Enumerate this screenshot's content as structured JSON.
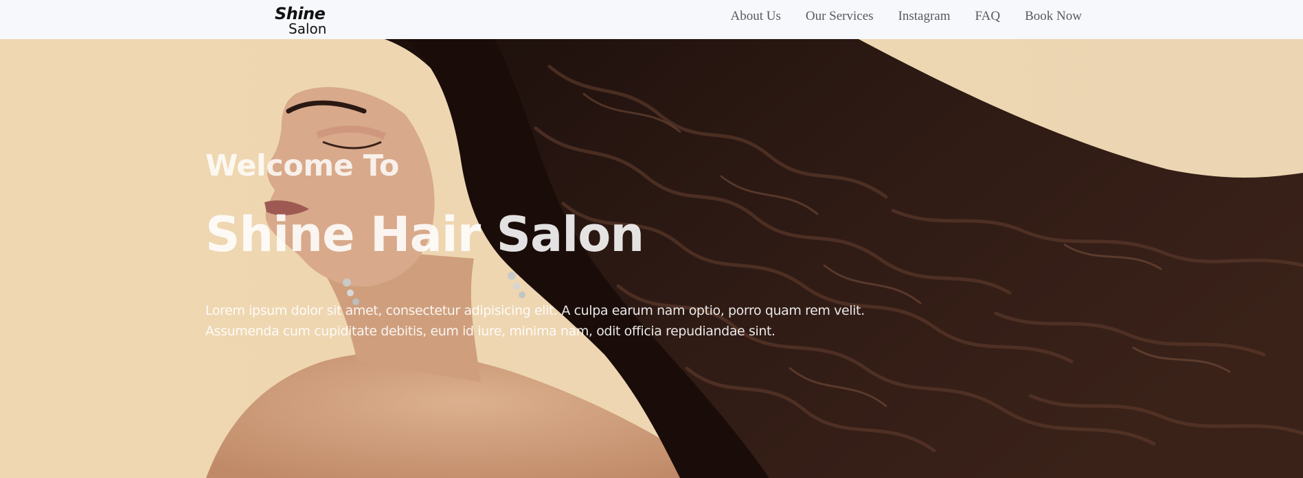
{
  "brand": {
    "logo_top": "Shine",
    "logo_bottom": "Salon"
  },
  "nav": {
    "items": [
      {
        "label": "About Us"
      },
      {
        "label": "Our Services"
      },
      {
        "label": "Instagram"
      },
      {
        "label": "FAQ"
      },
      {
        "label": "Book Now"
      }
    ]
  },
  "hero": {
    "welcome": "Welcome To",
    "title": "Shine Hair Salon",
    "description_line1": "Lorem ipsum dolor sit amet, consectetur adipisicing elit. A culpa earum nam optio, porro quam rem velit.",
    "description_line2": "Assumenda cum cupiditate debitis, eum id iure, minima nam, odit officia repudiandae sint."
  },
  "colors": {
    "nav_background": "#f6f8fc",
    "nav_text": "#555a60",
    "hero_background": "#efd7b0",
    "hair_color": "#2a1812"
  }
}
